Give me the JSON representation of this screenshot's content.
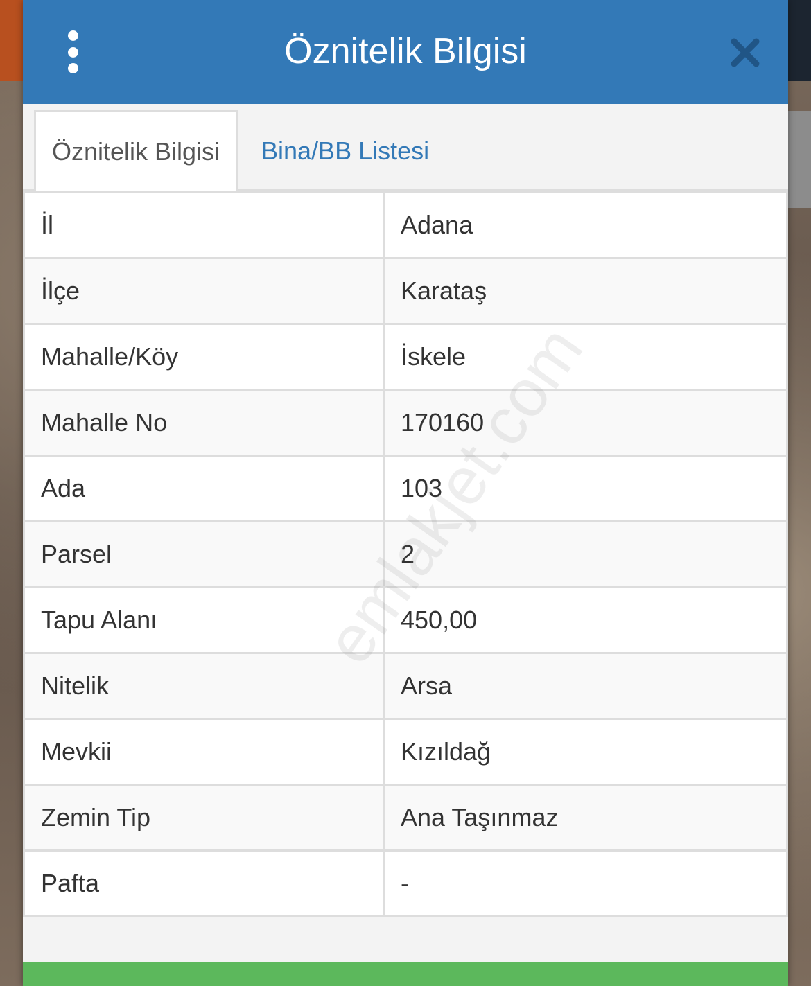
{
  "dialog": {
    "title": "Öznitelik Bilgisi",
    "menu_icon": "more-vertical-icon",
    "close_icon": "close-icon"
  },
  "tabs": [
    {
      "label": "Öznitelik Bilgisi",
      "active": true
    },
    {
      "label": "Bina/BB Listesi",
      "active": false
    }
  ],
  "rows": [
    {
      "key": "İl",
      "value": "Adana"
    },
    {
      "key": "İlçe",
      "value": "Karataş"
    },
    {
      "key": "Mahalle/Köy",
      "value": "İskele"
    },
    {
      "key": "Mahalle No",
      "value": "170160"
    },
    {
      "key": "Ada",
      "value": "103"
    },
    {
      "key": "Parsel",
      "value": "2"
    },
    {
      "key": "Tapu Alanı",
      "value": "450,00"
    },
    {
      "key": "Nitelik",
      "value": "Arsa"
    },
    {
      "key": "Mevkii",
      "value": "Kızıldağ"
    },
    {
      "key": "Zemin Tip",
      "value": "Ana Taşınmaz"
    },
    {
      "key": "Pafta",
      "value": "-"
    }
  ],
  "watermark": "emlakjet.com",
  "colors": {
    "header": "#3379b7",
    "tab_link": "#3379b7",
    "footer_bar": "#5cb85c",
    "border": "#dddddd"
  }
}
